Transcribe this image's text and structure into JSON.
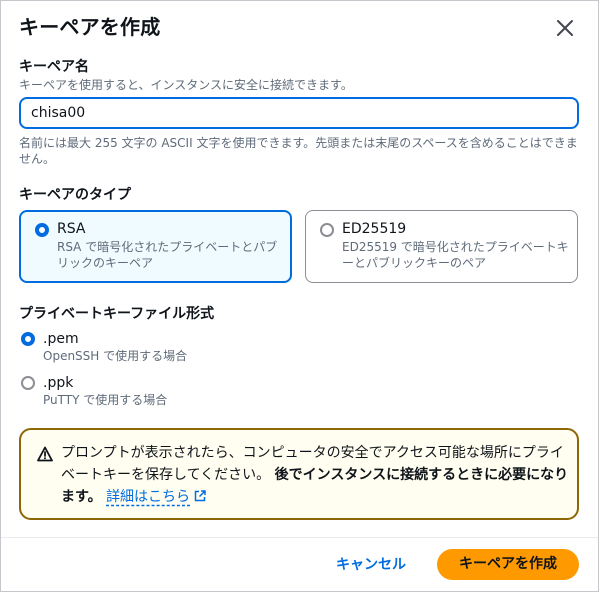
{
  "dialog": {
    "title": "キーペアを作成",
    "close_icon": "close-icon"
  },
  "key_name": {
    "label": "キーペア名",
    "description": "キーペアを使用すると、インスタンスに安全に接続できます。",
    "value": "chisa00",
    "hint": "名前には最大 255 文字の ASCII 文字を使用できます。先頭または末尾のスペースを含めることはできません。"
  },
  "key_type": {
    "label": "キーペアのタイプ",
    "options": [
      {
        "title": "RSA",
        "description": "RSA で暗号化されたプライベートとパブリックのキーペア",
        "selected": true
      },
      {
        "title": "ED25519",
        "description": "ED25519 で暗号化されたプライベートキーとパブリックキーのペア",
        "selected": false
      }
    ]
  },
  "file_format": {
    "label": "プライベートキーファイル形式",
    "options": [
      {
        "title": ".pem",
        "description": "OpenSSH で使用する場合",
        "selected": true
      },
      {
        "title": ".ppk",
        "description": "PuTTY で使用する場合",
        "selected": false
      }
    ]
  },
  "alert": {
    "icon": "warning-icon",
    "text": "プロンプトが表示されたら、コンピュータの安全でアクセス可能な場所にプライベートキーを保存してください。",
    "bold_text": "後でインスタンスに接続するときに必要になります。",
    "link_text": "詳細はこちら",
    "link_icon": "external-link-icon"
  },
  "footer": {
    "cancel_label": "キャンセル",
    "create_label": "キーペアを作成"
  },
  "colors": {
    "accent": "#006ce0",
    "primary_button": "#ff9900",
    "warning_border": "#8d6605"
  }
}
